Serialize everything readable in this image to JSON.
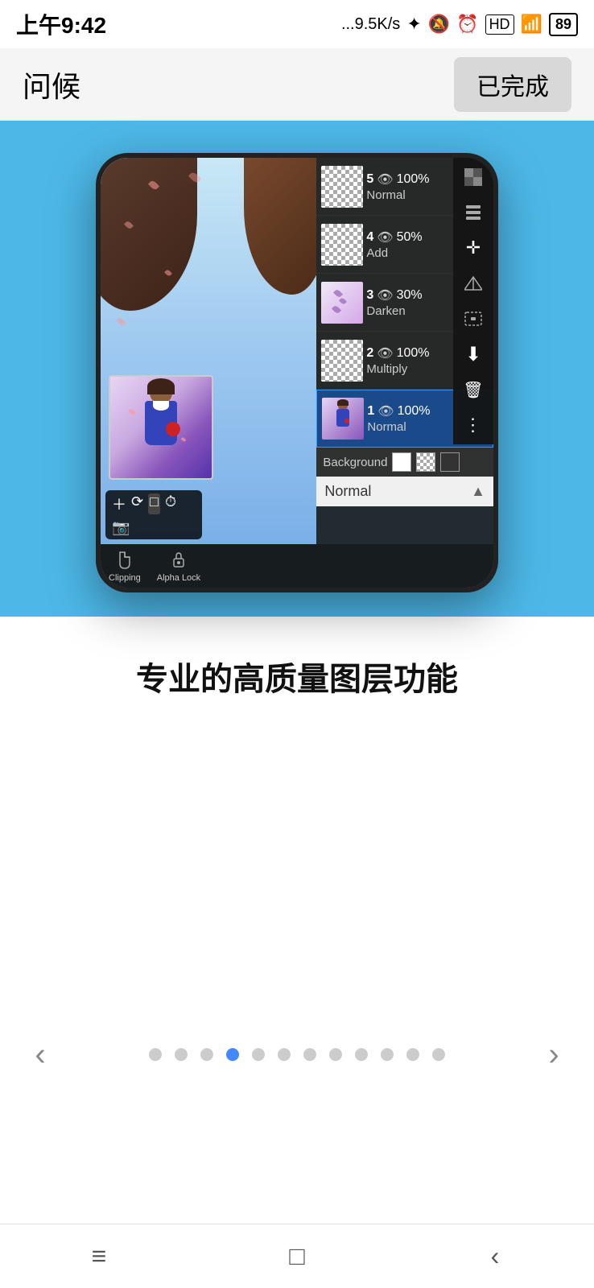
{
  "statusBar": {
    "time": "上午9:42",
    "network": "...9.5K/s",
    "battery": "89"
  },
  "topNav": {
    "title": "问候",
    "doneButton": "已完成"
  },
  "layerPanel": {
    "layers": [
      {
        "number": "5",
        "opacity": "100%",
        "mode": "Normal",
        "type": "transparent"
      },
      {
        "number": "4",
        "opacity": "50%",
        "mode": "Add",
        "type": "transparent"
      },
      {
        "number": "3",
        "opacity": "30%",
        "mode": "Darken",
        "type": "petals"
      },
      {
        "number": "2",
        "opacity": "100%",
        "mode": "Multiply",
        "type": "transparent"
      },
      {
        "number": "1",
        "opacity": "100%",
        "mode": "Normal",
        "type": "anime",
        "selected": true
      }
    ],
    "background": {
      "label": "Background",
      "swatches": [
        "white",
        "checkered",
        "dark"
      ]
    },
    "blendMode": "Normal",
    "tools": [
      "checkerboard",
      "layers",
      "move",
      "flip",
      "transform",
      "down-arrow",
      "trash",
      "more"
    ]
  },
  "bottomActions": {
    "clipping": "Clipping",
    "alphaLock": "Alpha Lock"
  },
  "featureTitle": "专业的高质量图层功能",
  "carousel": {
    "totalDots": 12,
    "activeDot": 3,
    "leftArrow": "‹",
    "rightArrow": "›"
  },
  "bottomNav": {
    "menu": "≡",
    "home": "□",
    "back": "‹"
  }
}
